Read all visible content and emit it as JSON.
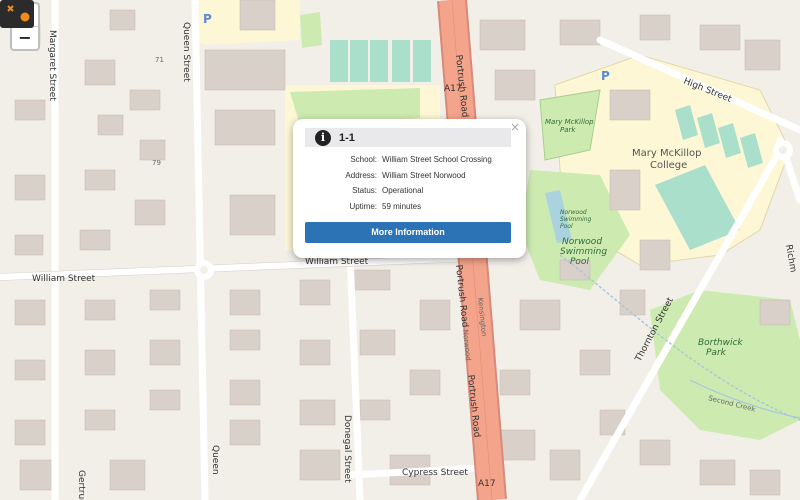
{
  "map": {
    "streets": {
      "william_street_west": "William Street",
      "william_street_east": "William Street",
      "margaret_street": "Margaret Street",
      "queen_street_top": "Queen Street",
      "queen_street_bottom": "Queen",
      "portrush_road_top": "Portrush Road",
      "portrush_road_mid": "Portrush Road",
      "portrush_road_bottom": "Portrush Road",
      "a17_top": "A17",
      "a17_bottom": "A17",
      "high_street": "High Street",
      "thornton_street": "Thornton Street",
      "cypress_street": "Cypress Street",
      "donegal_street": "Donegal Street",
      "gertrude": "Gertrud",
      "richmond": "Richm",
      "kensington": "Kensington",
      "norwood": "Norwood",
      "second_creek": "Second Creek"
    },
    "places": {
      "mary_mckillop_park": "Mary McKillop Park",
      "mary_mckillop_college": "Mary McKillop College",
      "norwood_pool_small": "Norwood Swimming Pool",
      "norwood_pool": "Norwood Swimming Pool",
      "borthwick_park": "Borthwick Park"
    },
    "house_numbers": {
      "n71": "71",
      "n79": "79"
    },
    "parking_icon": "parking-icon"
  },
  "controls": {
    "zoom_in": "+",
    "zoom_out": "−"
  },
  "popup": {
    "close": "×",
    "title": "1-1",
    "fields": [
      {
        "label": "School:",
        "value": "William Street School Crossing"
      },
      {
        "label": "Address:",
        "value": "William Street Norwood"
      },
      {
        "label": "Status:",
        "value": "Operational"
      },
      {
        "label": "Uptime:",
        "value": "59 minutes"
      }
    ],
    "button_label": "More Information"
  },
  "colors": {
    "primary_road": "#f4a48a",
    "road_casing": "#d9897a",
    "park": "#cdebb0",
    "school_area": "#fdf7d5",
    "building": "#d9d0c9",
    "pitch": "#aae0cb",
    "button": "#2b73b5",
    "marker_accent": "#f28a1c"
  }
}
